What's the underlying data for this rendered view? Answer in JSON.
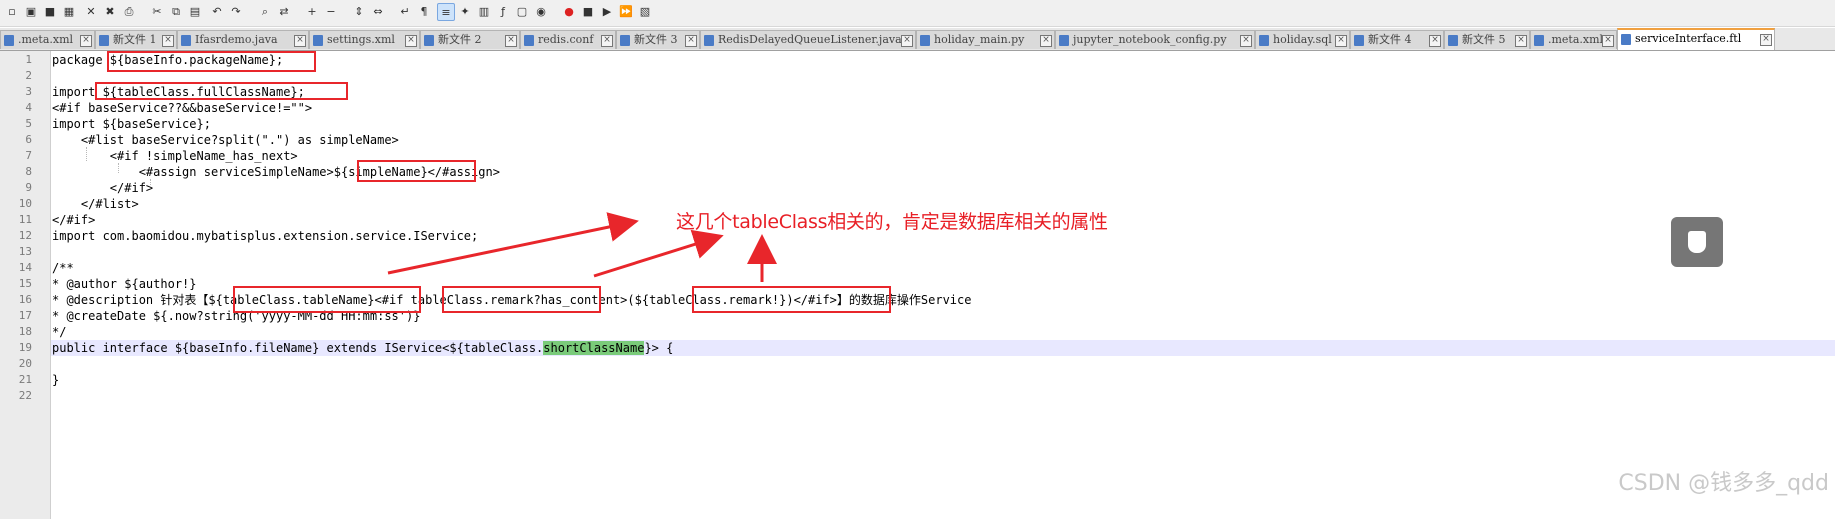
{
  "toolbar": {
    "icons": [
      "new-file-icon",
      "open-file-icon",
      "save-icon",
      "save-all-icon",
      "close-icon",
      "close-all-icon",
      "print-icon",
      "cut-icon",
      "copy-icon",
      "paste-icon",
      "undo-icon",
      "redo-icon",
      "find-icon",
      "replace-icon",
      "zoom-in-icon",
      "zoom-out-icon",
      "sync-vertical-icon",
      "sync-horizontal-icon",
      "word-wrap-icon",
      "show-all-chars-icon",
      "indent-guide-icon",
      "user-lang-icon",
      "doc-map-icon",
      "function-list-icon",
      "folder-workspace-icon",
      "monitoring-icon",
      "record-macro-icon",
      "stop-record-icon",
      "play-macro-icon",
      "run-macro-multiple-icon",
      "save-macro-icon"
    ]
  },
  "tabs": [
    {
      "label": ".meta.xml",
      "active": false
    },
    {
      "label": "新文件 1",
      "active": false
    },
    {
      "label": "Ifasrdemo.java",
      "active": false
    },
    {
      "label": "settings.xml",
      "active": false
    },
    {
      "label": "新文件 2",
      "active": false
    },
    {
      "label": "redis.conf",
      "active": false
    },
    {
      "label": "新文件 3",
      "active": false
    },
    {
      "label": "RedisDelayedQueueListener.java",
      "active": false
    },
    {
      "label": "holiday_main.py",
      "active": false
    },
    {
      "label": "jupyter_notebook_config.py",
      "active": false
    },
    {
      "label": "holiday.sql",
      "active": false
    },
    {
      "label": "新文件 4",
      "active": false
    },
    {
      "label": "新文件 5",
      "active": false
    },
    {
      "label": ".meta.xml",
      "active": false
    },
    {
      "label": "serviceInterface.ftl",
      "active": true
    }
  ],
  "editor": {
    "line_numbers": [
      "1",
      "2",
      "3",
      "4",
      "5",
      "6",
      "7",
      "8",
      "9",
      "10",
      "11",
      "12",
      "13",
      "14",
      "15",
      "16",
      "17",
      "18",
      "19",
      "20",
      "21",
      "22"
    ],
    "lines": [
      "package ${baseInfo.packageName};",
      "",
      "import ${tableClass.fullClassName};",
      "<#if baseService??&&baseService!=\"\">",
      "import ${baseService};",
      "    <#list baseService?split(\".\") as simpleName>",
      "        <#if !simpleName_has_next>",
      "            <#assign serviceSimpleName>${simpleName}</#assign>",
      "        </#if>",
      "    </#list>",
      "</#if>",
      "import com.baomidou.mybatisplus.extension.service.IService;",
      "",
      "/**",
      "* @author ${author!}",
      "* @description 针对表【${tableClass.tableName}<#if tableClass.remark?has_content>(${tableClass.remark!})</#if>】的数据库操作Service",
      "* @createDate ${.now?string('yyyy-MM-dd HH:mm:ss')}",
      "*/",
      "",
      "",
      "}",
      ""
    ],
    "line19": {
      "before": "public interface ${baseInfo.fileName} extends IService<${tableClass.",
      "highlight": "shortClassName",
      "after": "}> {"
    }
  },
  "annotation": {
    "text": "这几个tableClass相关的，肯定是数据库相关的属性",
    "color": "#e81f26"
  },
  "watermark": "CSDN @钱多多_qdd"
}
